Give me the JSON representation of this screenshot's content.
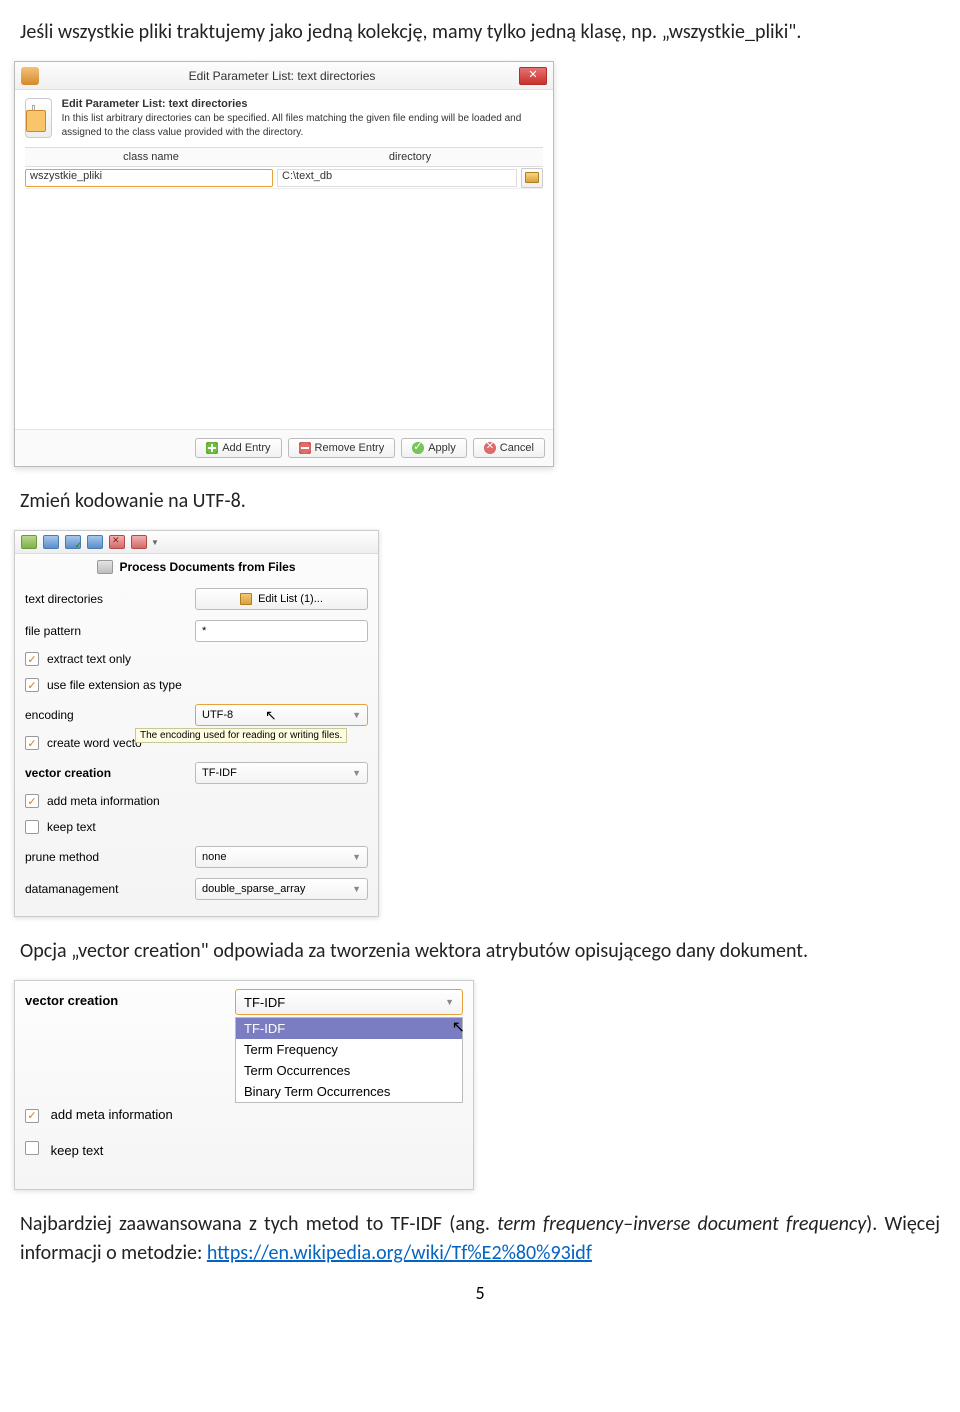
{
  "text_intro": "Jeśli wszystkie pliki traktujemy jako jedną kolekcję, mamy tylko jedną klasę, np. „wszystkie_pliki\".",
  "dialog1": {
    "title": "Edit Parameter List: text directories",
    "info_bold": "Edit Parameter List: text directories",
    "info_desc": "In this list arbitrary directories can be specified. All files matching the given file ending will be loaded and assigned to the class value provided with the directory.",
    "col_name": "class name",
    "col_dir": "directory",
    "row_class": "wszystkie_pliki",
    "row_dir": "C:\\text_db",
    "btn_add": "Add Entry",
    "btn_remove": "Remove Entry",
    "btn_apply": "Apply",
    "btn_cancel": "Cancel"
  },
  "text_utf8": "Zmień kodowanie na UTF-8.",
  "panel2": {
    "title": "Process Documents from Files",
    "labels": {
      "text_directories": "text directories",
      "file_pattern": "file pattern",
      "extract_text_only": "extract text only",
      "use_file_ext": "use file extension as type",
      "encoding": "encoding",
      "create_word_vector": "create word vecto",
      "vector_creation": "vector creation",
      "add_meta": "add meta information",
      "keep_text": "keep text",
      "prune_method": "prune method",
      "datamanagement": "datamanagement"
    },
    "values": {
      "edit_list": "Edit List (1)...",
      "file_pattern": "*",
      "encoding": "UTF-8",
      "vector_creation": "TF-IDF",
      "prune_method": "none",
      "datamanagement": "double_sparse_array"
    },
    "tooltip": "The encoding used for reading or writing files."
  },
  "text_vector_creation": "Opcja „vector creation\" odpowiada za tworzenia wektora atrybutów opisującego dany dokument.",
  "panel3": {
    "labels": {
      "vector_creation": "vector creation",
      "add_meta": "add meta information",
      "keep_text": "keep text"
    },
    "selected": "TF-IDF",
    "options": [
      "TF-IDF",
      "Term Frequency",
      "Term Occurrences",
      "Binary Term Occurrences"
    ]
  },
  "text_final_a": "Najbardziej zaawansowana z tych metod to TF-IDF (ang. ",
  "text_final_italic": "term frequency–inverse document frequency",
  "text_final_b": "). Więcej informacji o metodzie: ",
  "link_text": "https://en.wikipedia.org/wiki/Tf%E2%80%93idf",
  "page_num": "5"
}
